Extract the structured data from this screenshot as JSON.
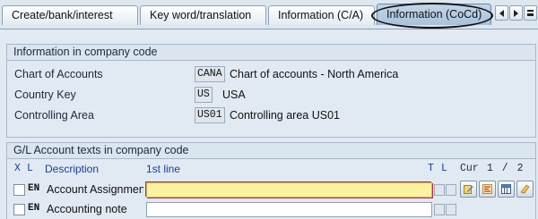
{
  "tabs": [
    {
      "label": "Create/bank/interest"
    },
    {
      "label": "Key word/translation"
    },
    {
      "label": "Information (C/A)"
    },
    {
      "label": "Information (CoCd)"
    }
  ],
  "info_group": {
    "title": "Information in company code",
    "fields": [
      {
        "label": "Chart of Accounts",
        "code": "CANA",
        "description": "Chart of accounts - North America"
      },
      {
        "label": "Country Key",
        "code": "US",
        "description": "USA"
      },
      {
        "label": "Controlling Area",
        "code": "US01",
        "description": "Controlling area US01"
      }
    ]
  },
  "texts_group": {
    "title": "G/L Account texts in company code",
    "headers": {
      "x": "X",
      "l": "L",
      "description": "Description",
      "first_line": "1st line",
      "t": "T",
      "l2": "L",
      "cur": "Cur",
      "page": "1 / 2"
    },
    "rows": [
      {
        "lang": "EN",
        "description": "Account Assignment",
        "value": ""
      },
      {
        "lang": "EN",
        "description": "Accounting note",
        "value": ""
      }
    ],
    "toolbar_icons": [
      "edit-text-icon",
      "format-text-icon",
      "table-view-icon",
      "delete-text-icon"
    ]
  },
  "colors": {
    "active_tab": "#a9c2db",
    "focus_field": "#fbf3a0",
    "header_text": "#1a3d9e"
  }
}
